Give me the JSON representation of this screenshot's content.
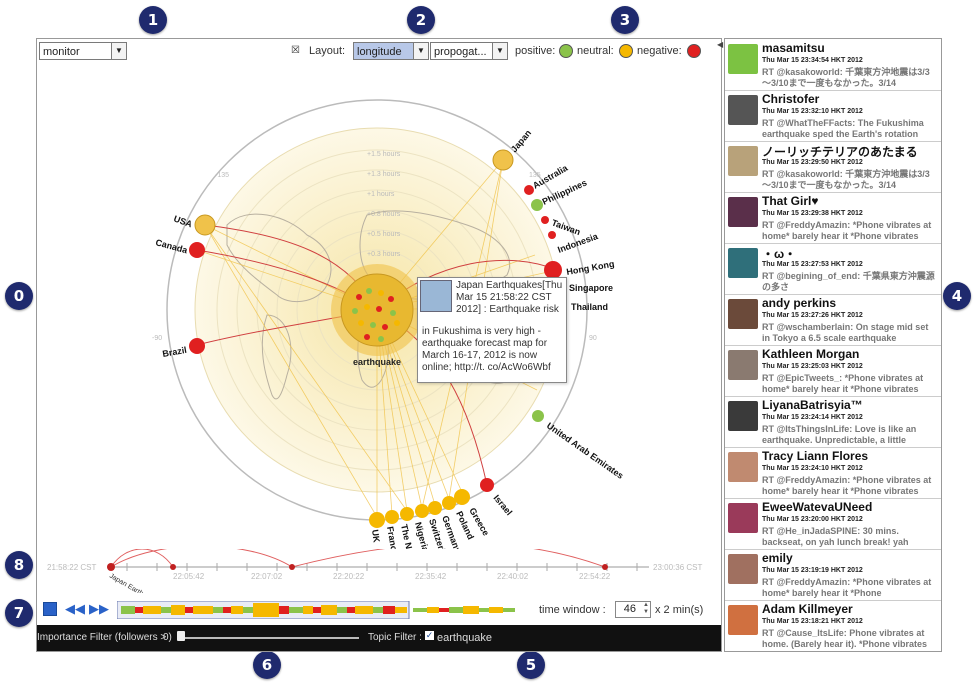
{
  "badges": [
    "1",
    "2",
    "3",
    "0",
    "4",
    "8",
    "7",
    "6",
    "5"
  ],
  "toolbar": {
    "monitor_value": "monitor",
    "layout_label": "Layout:",
    "layout_value": "longitude",
    "propagation_value": "propogat...",
    "positive_label": "positive:",
    "neutral_label": "neutral:",
    "negative_label": "negative:",
    "colors": {
      "positive": "#8bc34a",
      "neutral": "#f5b800",
      "negative": "#e02020"
    }
  },
  "map": {
    "center_label": "earthquake",
    "ring_labels": [
      "+1.5 hours",
      "+1.3 hours",
      "+1 hours",
      "+0.8 hours",
      "+0.5 hours",
      "+0.3 hours"
    ],
    "degree_labels": [
      "-90",
      "90",
      "-135",
      "135"
    ],
    "countries": [
      "Japan",
      "Australia",
      "Philippines",
      "Taiwan",
      "Indonesia",
      "Hong Kong",
      "Singapore",
      "Thailand",
      "United Arab Emirates",
      "Israel",
      "Greece",
      "Poland",
      "Germany",
      "Switzerland",
      "Nigeria",
      "The Nethe",
      "France",
      "UK",
      "USA",
      "Canada",
      "Brazil"
    ]
  },
  "tooltip": {
    "header": "Japan Earthquakes[Thu Mar 15 21:58:22 CST 2012] : Earthquake risk",
    "body": "in Fukushima is very high - earthquake forecast map for March 16-17, 2012 is now online; http://t. co/AcWo6Wbf"
  },
  "timeline": {
    "start": "21:58:22 CST",
    "end": "23:00:36 CST",
    "event_label": "Japan Earthquakes",
    "ticks": [
      "22:05:42",
      "22:07:02",
      "22:20:22",
      "22:35:42",
      "22:40:02",
      "22:54:22"
    ]
  },
  "controls": {
    "time_window_label": "time window :",
    "time_window_value": "46",
    "time_window_unit": "x 2 min(s)"
  },
  "filters": {
    "importance_label": "Importance Filter (followers >",
    "importance_value": "0)",
    "topic_label": "Topic Filter :",
    "topic_value": "earthquake"
  },
  "tweets": [
    {
      "name": "masamitsu",
      "time": "Thu Mar 15 23:34:54 HKT 2012",
      "text": "RT @kasakoworld: 千葉東方沖地震は3/3～3/10まで一度もなかった。3/14",
      "avatar": "#7cc242"
    },
    {
      "name": "Christofer",
      "time": "Thu Mar 15 23:32:10 HKT 2012",
      "text": "RT @WhatTheFFacts: The Fukushima earthquake sped the Earth's rotation",
      "avatar": "#555555"
    },
    {
      "name": "ノーリッチテリアのあたまる",
      "time": "Thu Mar 15 23:29:50 HKT 2012",
      "text": "RT @kasakoworld: 千葉東方沖地震は3/3～3/10まで一度もなかった。3/14",
      "avatar": "#b8a27a"
    },
    {
      "name": "That Girl♥",
      "time": "Thu Mar 15 23:29:38 HKT 2012",
      "text": "RT @FreddyAmazin: *Phone vibrates at home* barely hear it *Phone vibrates",
      "avatar": "#5a2f4a"
    },
    {
      "name": "・ω・",
      "time": "Thu Mar 15 23:27:53 HKT 2012",
      "text": "RT @begining_of_end: 千葉県東方沖震源の多さ",
      "avatar": "#2f6f7a"
    },
    {
      "name": "andy perkins",
      "time": "Thu Mar 15 23:27:26 HKT 2012",
      "text": "RT @wschamberlain: On stage mid set in Tokyo a 6.5 scale earthquake",
      "avatar": "#6b4a3a"
    },
    {
      "name": "Kathleen Morgan",
      "time": "Thu Mar 15 23:25:03 HKT 2012",
      "text": "RT @EpicTweets_: *Phone vibrates at home* barely hear it *Phone vibrates",
      "avatar": "#8a7a70"
    },
    {
      "name": "LiyanaBatrisyia™",
      "time": "Thu Mar 15 23:24:14 HKT 2012",
      "text": "RT @ItsThingsInLife: Love is like an earthquake. Unpredictable, a little",
      "avatar": "#3a3a3a"
    },
    {
      "name": "Tracy Liann Flores",
      "time": "Thu Mar 15 23:24:10 HKT 2012",
      "text": "RT @FreddyAmazin: *Phone vibrates at home* barely hear it *Phone vibrates",
      "avatar": "#c08a70"
    },
    {
      "name": "EweeWatevaUNeed",
      "time": "Thu Mar 15 23:20:00 HKT 2012",
      "text": "RT @He_inJadaSPINE: 30 mins. backseat, on yah lunch break! yah",
      "avatar": "#9a3a5a"
    },
    {
      "name": "emily",
      "time": "Thu Mar 15 23:19:19 HKT 2012",
      "text": "RT @FreddyAmazin: *Phone vibrates at home* barely hear it *Phone",
      "avatar": "#a07060"
    },
    {
      "name": "Adam Killmeyer",
      "time": "Thu Mar 15 23:18:21 HKT 2012",
      "text": "RT @Cause_ItsLife: Phone vibrates at home. (Barely hear it). *Phone vibrates",
      "avatar": "#d07040"
    }
  ]
}
